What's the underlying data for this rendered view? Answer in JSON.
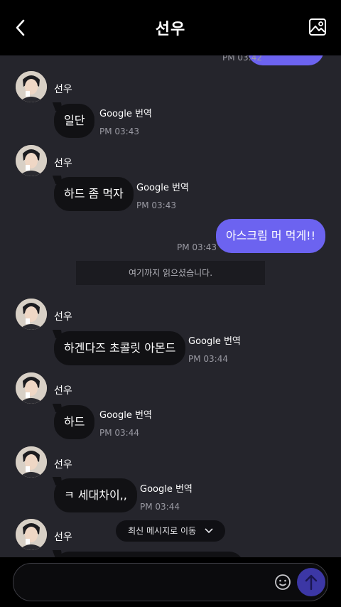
{
  "header": {
    "title": "선우"
  },
  "chat": {
    "partial_time": "PM 03:42",
    "messages": [
      {
        "sender": "선우",
        "text": "일단",
        "translate": "Google 번역",
        "time": "PM 03:43"
      },
      {
        "sender": "선우",
        "text": "하드 좀 먹자",
        "translate": "Google 번역",
        "time": "PM 03:43"
      },
      {
        "text": "아스크림 머 먹게!!",
        "time": "PM 03:43"
      },
      {
        "sender": "선우",
        "text": "하겐다즈 초콜릿 아몬드",
        "translate": "Google 번역",
        "time": "PM 03:44"
      },
      {
        "sender": "선우",
        "text": "하드",
        "translate": "Google 번역",
        "time": "PM 03:44"
      },
      {
        "sender": "선우",
        "text": "ㅋ 세대차이,,",
        "translate": "Google 번역",
        "time": "PM 03:44"
      },
      {
        "sender": "선우"
      }
    ],
    "read_notice": "여기까지 읽으셨습니다.",
    "jump_label": "최신 메시지로 이동"
  },
  "colors": {
    "outgoing": "#6c63f0",
    "send_button": "#3c37a5"
  }
}
